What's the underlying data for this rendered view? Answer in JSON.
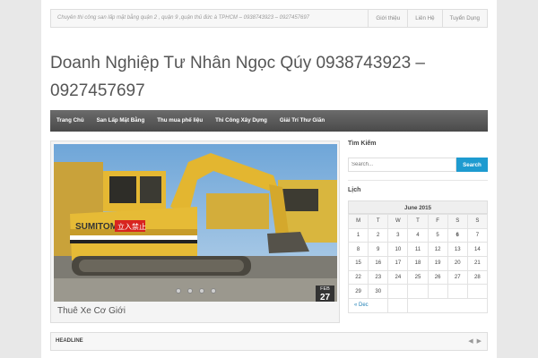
{
  "topbar": {
    "tagline": "Chuyên thi công san lấp mặt bằng quận 2 , quận 9 ,quận thủ đức à TPHCM – 0938743923 – 0927457697",
    "links": [
      "Giới thiệu",
      "Liên Hệ",
      "Tuyển Dụng"
    ]
  },
  "site": {
    "title": "Doanh Nghiệp Tư Nhân Ngọc Qúy 0938743923 – 0927457697"
  },
  "nav": {
    "items": [
      "Trang Chủ",
      "San Lấp Mặt Bằng",
      "Thu mua phế liệu",
      "Thi Công Xây Dựng",
      "Giải Trí Thư Giãn"
    ]
  },
  "slider": {
    "brand_text": "SUMITOMO",
    "sign_text": "立入禁止",
    "date_month": "FEB",
    "date_day": "27",
    "caption": "Thuê Xe Cơ Giới",
    "dots": 4
  },
  "sidebar": {
    "search_title": "Tìm Kiếm",
    "search_placeholder": "Search...",
    "search_button": "Search",
    "calendar_title": "Lịch",
    "calendar": {
      "caption": "June 2015",
      "weekdays": [
        "M",
        "T",
        "W",
        "T",
        "F",
        "S",
        "S"
      ],
      "weeks": [
        [
          "1",
          "2",
          "3",
          "4",
          "5",
          "6",
          "7"
        ],
        [
          "8",
          "9",
          "10",
          "11",
          "12",
          "13",
          "14"
        ],
        [
          "15",
          "16",
          "17",
          "18",
          "19",
          "20",
          "21"
        ],
        [
          "22",
          "23",
          "24",
          "25",
          "26",
          "27",
          "28"
        ],
        [
          "29",
          "30",
          "",
          "",
          "",
          "",
          ""
        ]
      ],
      "today": "6",
      "prev_link": "« Dec"
    }
  },
  "headline": {
    "label": "HEADLINE",
    "prev_icon": "arrow-left-icon",
    "next_icon": "arrow-right-icon"
  }
}
